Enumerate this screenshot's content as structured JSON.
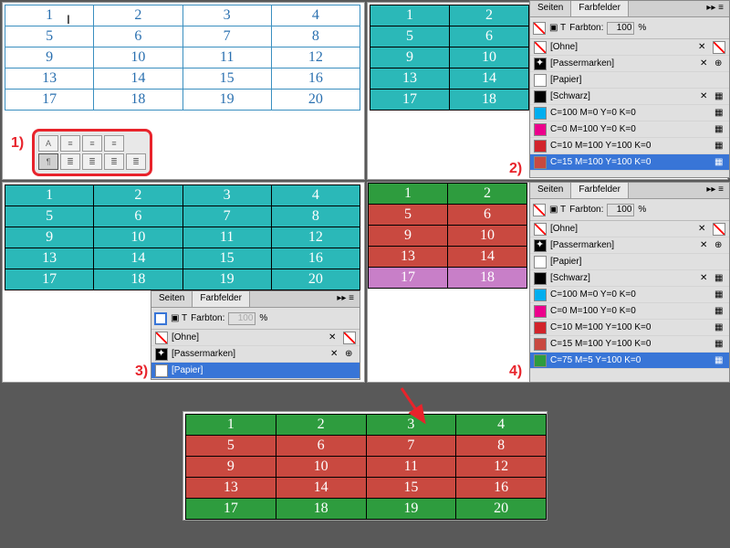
{
  "labels": {
    "l1": "1)",
    "l2": "2)",
    "l3": "3)",
    "l4": "4)"
  },
  "grid": [
    [
      "1",
      "2",
      "3",
      "4"
    ],
    [
      "5",
      "6",
      "7",
      "8"
    ],
    [
      "9",
      "10",
      "11",
      "12"
    ],
    [
      "13",
      "14",
      "15",
      "16"
    ],
    [
      "17",
      "18",
      "19",
      "20"
    ]
  ],
  "grid4": [
    [
      "1",
      "2"
    ],
    [
      "5",
      "6"
    ],
    [
      "9",
      "10"
    ],
    [
      "13",
      "14"
    ],
    [
      "17",
      "18"
    ]
  ],
  "panel": {
    "tab_seiten": "Seiten",
    "tab_farbfelder": "Farbfelder",
    "farbton_label": "Farbton:",
    "farbton_val": "100",
    "percent": "%",
    "sw_ohne": "[Ohne]",
    "sw_passer": "[Passermarken]",
    "sw_papier": "[Papier]",
    "sw_schwarz": "[Schwarz]",
    "sw_c100": "C=100 M=0 Y=0 K=0",
    "sw_m100": "C=0 M=100 Y=0 K=0",
    "sw_c10m100": "C=10 M=100 Y=100 K=0",
    "sw_c15": "C=15 M=100 Y=100 K=0",
    "sw_c75": "C=75 M=5 Y=100 K=0"
  }
}
